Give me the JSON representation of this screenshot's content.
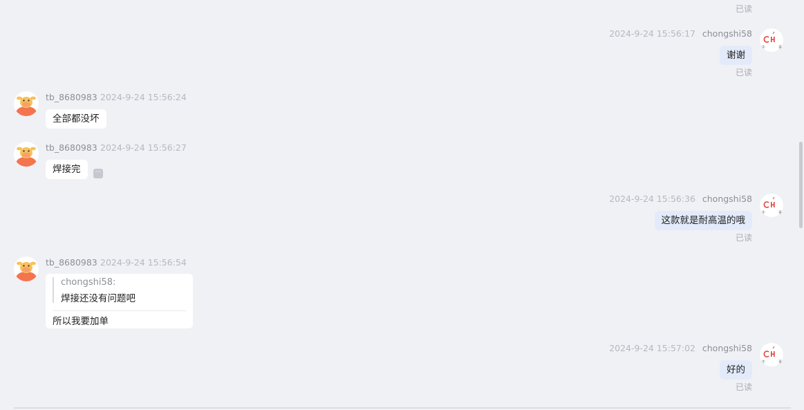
{
  "colors": {
    "background": "#f0f1f5",
    "bubble_self": "#e3ebfa",
    "bubble_other": "#ffffff",
    "meta_text": "#b5b8c0"
  },
  "messages": [
    {
      "side": "right",
      "read": "已读"
    },
    {
      "side": "right",
      "time": "2024-9-24 15:56:17",
      "sender": "chongshi58",
      "text": "谢谢",
      "read": "已读"
    },
    {
      "side": "left",
      "sender": "tb_8680983",
      "time": "2024-9-24 15:56:24",
      "text": "全部都没坏"
    },
    {
      "side": "left",
      "sender": "tb_8680983",
      "time": "2024-9-24 15:56:27",
      "text": "焊接完",
      "more_icon": "ellipsis-icon"
    },
    {
      "side": "right",
      "time": "2024-9-24 15:56:36",
      "sender": "chongshi58",
      "text": "这款就是耐高温的哦",
      "read": "已读"
    },
    {
      "side": "left",
      "sender": "tb_8680983",
      "time": "2024-9-24 15:56:54",
      "quote": {
        "name": "chongshi58:",
        "text": "焊接还没有问题吧"
      },
      "text": "所以我要加单"
    },
    {
      "side": "right",
      "time": "2024-9-24 15:57:02",
      "sender": "chongshi58",
      "text": "好的",
      "read": "已读"
    }
  ],
  "avatars": {
    "left_icon": "cartoon-cow-avatar-icon",
    "right_icon": "shop-logo-avatar-icon"
  }
}
